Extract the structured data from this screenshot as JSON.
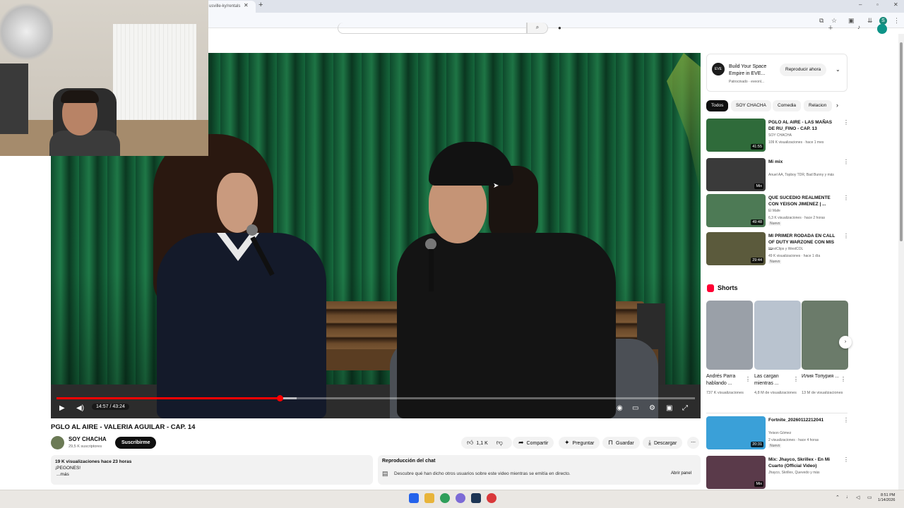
{
  "browser": {
    "tab_title": "usville-ky/rentals",
    "new_tab": "+",
    "profile_initial": "S"
  },
  "video": {
    "title": "PGLO AL AIRE - VALERIA AGUILAR - CAP. 14",
    "time": "14:57 / 43:24",
    "progress": 0.35
  },
  "channel": {
    "name": "SOY CHACHA",
    "subs": "29,5 K suscriptores",
    "subscribe": "Suscribirme"
  },
  "actions": {
    "likes": "1,1 K",
    "share": "Compartir",
    "ask": "Preguntar",
    "save": "Guardar",
    "download": "Descargar"
  },
  "description": {
    "meta": "19 K visualizaciones  hace 23 horas",
    "line1": "¡PEGONES!",
    "more": "...más"
  },
  "chat": {
    "title": "Reproducción del chat",
    "desc": "Descubre qué han dicho otros usuarios sobre este video mientras se emitía en directo.",
    "open": "Abrir panel"
  },
  "ad": {
    "logo": "EVE",
    "title": "Build Your Space Empire in EVE...",
    "sponsor": "Patrocinado · eveonl...",
    "button": "Reproducir ahora"
  },
  "chips": [
    "Todos",
    "SOY CHACHA",
    "Comedia",
    "Relacion"
  ],
  "recommendations": [
    {
      "title": "PGLO AL AIRE - LAS MAÑAS DE RU_FINO - CAP. 13",
      "channel": "SOY CHACHA",
      "meta": "109 K visualizaciones · hace 1 mes",
      "duration": "41:55",
      "badge": "",
      "thumb": "#2f6b3a"
    },
    {
      "title": "Mi mix",
      "channel": "Anuel AA, Topboy TDR, Bad Bunny y más",
      "meta": "",
      "duration": "Mix",
      "badge": "",
      "thumb": "#3a3a3a"
    },
    {
      "title": "QUE SUCEDIO REALMENTE CON YEISON JIMENEZ | ...",
      "channel": "El Mafe",
      "meta": "6,3 K visualizaciones · hace 2 horas",
      "duration": "49:48",
      "badge": "Nuevo",
      "thumb": "#4d7a55"
    },
    {
      "title": "MI PRIMER RODADA EN CALL OF DUTY WARZONE CON MIS ...",
      "channel": "WestClips y WestCOL",
      "meta": "49 K visualizaciones · hace 1 día",
      "duration": "29:44",
      "badge": "Nuevo",
      "thumb": "#5b5a3c"
    }
  ],
  "shorts": {
    "heading": "Shorts",
    "items": [
      {
        "title": "Andrés Parra hablando ...",
        "views": "737 K visualizaciones",
        "thumb": "#9aa0a8"
      },
      {
        "title": "Las cargan mientras ...",
        "views": "4,8 M de visualizaciones",
        "thumb": "#b9c3cf"
      },
      {
        "title": "Илия Топурия ...",
        "views": "13 M de visualizaciones",
        "thumb": "#6b7b6a"
      }
    ]
  },
  "more_recs": [
    {
      "title": "Fortnite_20260112212041",
      "channel": "Yeison Gómez",
      "meta": "2 visualizaciones · hace 4 horas",
      "duration": "20:31",
      "badge": "Nuevo",
      "thumb": "#3aa0d8"
    },
    {
      "title": "Mix: Jhayco, Skrillex - En Mi Cuarto (Official Video)",
      "channel": "Jhayco, Skrillex, Quevedo y más",
      "meta": "",
      "duration": "Mix",
      "badge": "",
      "thumb": "#5a3a4a"
    }
  ],
  "clock": {
    "time": "8:51 PM",
    "date": "1/14/2026"
  }
}
